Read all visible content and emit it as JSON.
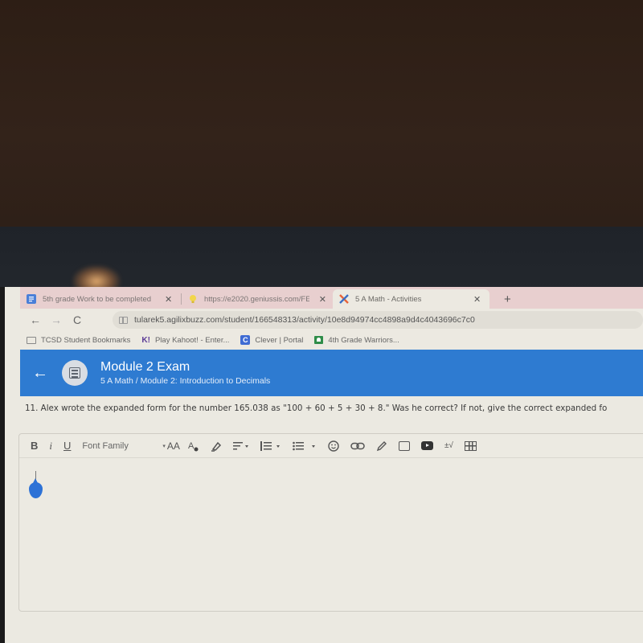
{
  "browser": {
    "tabs": [
      {
        "title": "5th grade Work to be completed",
        "icon": "google-docs-icon",
        "active": false
      },
      {
        "title": "https://e2020.geniussis.com/FE",
        "icon": "lightbulb-icon",
        "active": false
      },
      {
        "title": "5 A Math - Activities",
        "icon": "buzz-x-icon",
        "active": true
      }
    ],
    "close_glyph": "✕",
    "new_tab_glyph": "+",
    "nav": {
      "back": "←",
      "forward": "→",
      "reload": "C"
    },
    "url": "tularek5.agilixbuzz.com/student/166548313/activity/10e8d94974cc4898a9d4c4043696c7c0",
    "bookmarks": [
      {
        "label": "TCSD Student Bookmarks",
        "icon": "folder-icon"
      },
      {
        "label": "Play Kahoot! - Enter...",
        "icon": "kahoot-icon",
        "glyph": "K!"
      },
      {
        "label": "Clever | Portal",
        "icon": "clever-icon",
        "glyph": "C"
      },
      {
        "label": "4th Grade Warriors...",
        "icon": "google-classroom-icon"
      }
    ]
  },
  "header": {
    "back_glyph": "←",
    "title": "Module 2 Exam",
    "breadcrumb": "5 A Math / Module 2: Introduction to Decimals",
    "color": "#2e7bd1"
  },
  "question": {
    "text": "11. Alex wrote the expanded form for the number 165.038 as \"100 + 60 + 5 + 30 + 8.\" Was he correct? If not, give the correct expanded fo"
  },
  "editor": {
    "toolbar": {
      "bold": "B",
      "italic": "i",
      "underline": "U",
      "font_family": "Font Family",
      "font_size": "AA",
      "caret": "▾",
      "formula": "±√"
    },
    "content": "",
    "cursor_color": "#2d72d6"
  }
}
